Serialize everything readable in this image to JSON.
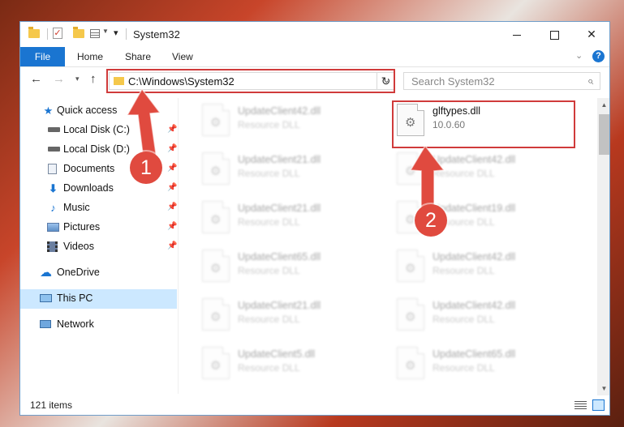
{
  "window": {
    "title": "System32",
    "qa_checkmark": "✓",
    "controls": {
      "minimize": "",
      "maximize": "",
      "close": "✕"
    }
  },
  "ribbon": {
    "file": "File",
    "tabs": [
      "Home",
      "Share",
      "View"
    ],
    "help": "?"
  },
  "address": {
    "path": "C:\\Windows\\System32",
    "search_placeholder": "Search System32"
  },
  "sidebar": {
    "items": [
      {
        "label": "Quick access",
        "icon": "star-icon"
      },
      {
        "label": "Local Disk (C:)",
        "icon": "drive-icon"
      },
      {
        "label": "Local Disk (D:)",
        "icon": "drive-icon"
      },
      {
        "label": "Documents",
        "icon": "documents-icon"
      },
      {
        "label": "Downloads",
        "icon": "download-icon"
      },
      {
        "label": "Music",
        "icon": "music-icon"
      },
      {
        "label": "Pictures",
        "icon": "pictures-icon"
      },
      {
        "label": "Videos",
        "icon": "videos-icon"
      },
      {
        "label": "OneDrive",
        "icon": "cloud-icon"
      },
      {
        "label": "This PC",
        "icon": "computer-icon"
      },
      {
        "label": "Network",
        "icon": "network-icon"
      }
    ]
  },
  "files": {
    "highlighted": {
      "name": "glftypes.dll",
      "sub": "10.0.60"
    },
    "col1": [
      {
        "name": "UpdateClient42.dll",
        "sub": "Resource DLL"
      },
      {
        "name": "UpdateClient21.dll",
        "sub": "Resource DLL"
      },
      {
        "name": "UpdateClient21.dll",
        "sub": "Resource DLL"
      },
      {
        "name": "UpdateClient65.dll",
        "sub": "Resource DLL"
      },
      {
        "name": "UpdateClient21.dll",
        "sub": "Resource DLL"
      },
      {
        "name": "UpdateClient5.dll",
        "sub": "Resource DLL"
      }
    ],
    "col2": [
      {
        "name": "UpdateClient42.dll",
        "sub": "Resource DLL"
      },
      {
        "name": "UpdateClient19.dll",
        "sub": "Resource DLL"
      },
      {
        "name": "UpdateClient42.dll",
        "sub": "Resource DLL"
      },
      {
        "name": "UpdateClient42.dll",
        "sub": "Resource DLL"
      },
      {
        "name": "UpdateClient65.dll",
        "sub": "Resource DLL"
      }
    ]
  },
  "status": {
    "item_count": "121 items"
  },
  "annotations": {
    "step1": "1",
    "step2": "2"
  },
  "colors": {
    "accent": "#1a75d1",
    "highlight_frame": "#d03b3b",
    "annotation": "#e04a3f",
    "selected_bg": "#cce8ff"
  }
}
